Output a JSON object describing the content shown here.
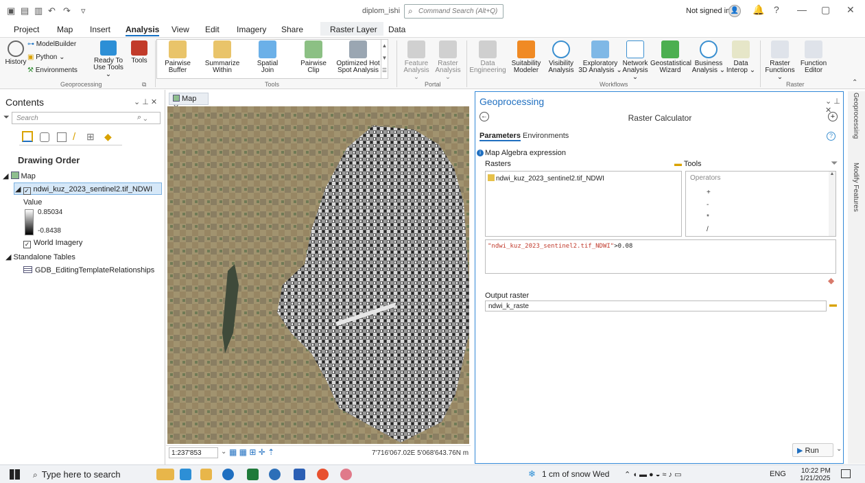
{
  "titlebar": {
    "document": "diplom_ishi",
    "command_search_placeholder": "Command Search (Alt+Q)",
    "signin": "Not signed in",
    "help": "?",
    "minimize": "—",
    "restore": "▢",
    "close": "✕"
  },
  "tabs": [
    "Project",
    "Map",
    "Insert",
    "Analysis",
    "View",
    "Edit",
    "Imagery",
    "Share",
    "Raster Layer",
    "Data"
  ],
  "ribbon": {
    "history": "History",
    "modelbuilder": "ModelBuilder",
    "python": "Python ⌄",
    "environments": "Environments",
    "ready_to_use": "Ready To",
    "ready_to_use_2": "Use Tools ⌄",
    "tools": "Tools",
    "geoprocessing_group": "Geoprocessing",
    "pairwise_buffer": [
      "Pairwise",
      "Buffer"
    ],
    "summarize_within": [
      "Summarize",
      "Within"
    ],
    "spatial_join": [
      "Spatial",
      "Join"
    ],
    "pairwise_clip": [
      "Pairwise",
      "Clip"
    ],
    "optimized_hot": [
      "Optimized Hot",
      "Spot Analysis"
    ],
    "tools_group": "Tools",
    "feature_analysis": [
      "Feature",
      "Analysis ⌄"
    ],
    "raster_analysis": [
      "Raster",
      "Analysis ⌄"
    ],
    "portal_group": "Portal",
    "data_engineering": [
      "Data",
      "Engineering"
    ],
    "suitability": [
      "Suitability",
      "Modeler"
    ],
    "visibility": [
      "Visibility",
      "Analysis"
    ],
    "exploratory": [
      "Exploratory",
      "3D Analysis ⌄"
    ],
    "network": [
      "Network",
      "Analysis ⌄"
    ],
    "geostatistical": [
      "Geostatistical",
      "Wizard"
    ],
    "business": [
      "Business",
      "Analysis ⌄"
    ],
    "data_interop": [
      "Data",
      "Interop ⌄"
    ],
    "workflows_group": "Workflows",
    "raster_functions": [
      "Raster",
      "Functions ⌄"
    ],
    "function_editor": [
      "Function",
      "Editor"
    ],
    "raster_group": "Raster"
  },
  "contents": {
    "title": "Contents",
    "search_placeholder": "Search",
    "drawing_order": "Drawing Order",
    "map": "Map",
    "layer": "ndwi_kuz_2023_sentinel2.tif_NDWI",
    "value_label": "Value",
    "value_max": "0.85034",
    "value_min": "-0.8438",
    "world_imagery": "World Imagery",
    "standalone": "Standalone Tables",
    "table": "GDB_EditingTemplateRelationships"
  },
  "map": {
    "tab": "Map",
    "scale": "1:237'853",
    "coords": "7'716'067.02E 5'068'643.76N m"
  },
  "gp": {
    "title": "Geoprocessing",
    "tool": "Raster Calculator",
    "tab_parameters": "Parameters",
    "tab_environments": "Environments",
    "expr_label": "Map Algebra expression",
    "rasters_label": "Rasters",
    "tools_label": "Tools",
    "raster_item": "ndwi_kuz_2023_sentinel2.tif_NDWI",
    "operators_label": "Operators",
    "operators": [
      "+",
      "-",
      "*",
      "/"
    ],
    "expression_quoted": "\"ndwi_kuz_2023_sentinel2.tif_NDWI\"",
    "expression_rest": ">0.08",
    "output_label": "Output raster",
    "output_value": "ndwi_k_raste",
    "run": "Run"
  },
  "side_tabs": [
    "Geoprocessing",
    "Modify Features"
  ],
  "taskbar": {
    "search": "Type here to search",
    "weather": "1 cm of snow Wed",
    "lang": "ENG",
    "time": "10:22 PM",
    "date": "1/21/2025"
  },
  "colors": {
    "accent": "#1f6fc0",
    "expr_string": "#c0392b"
  }
}
